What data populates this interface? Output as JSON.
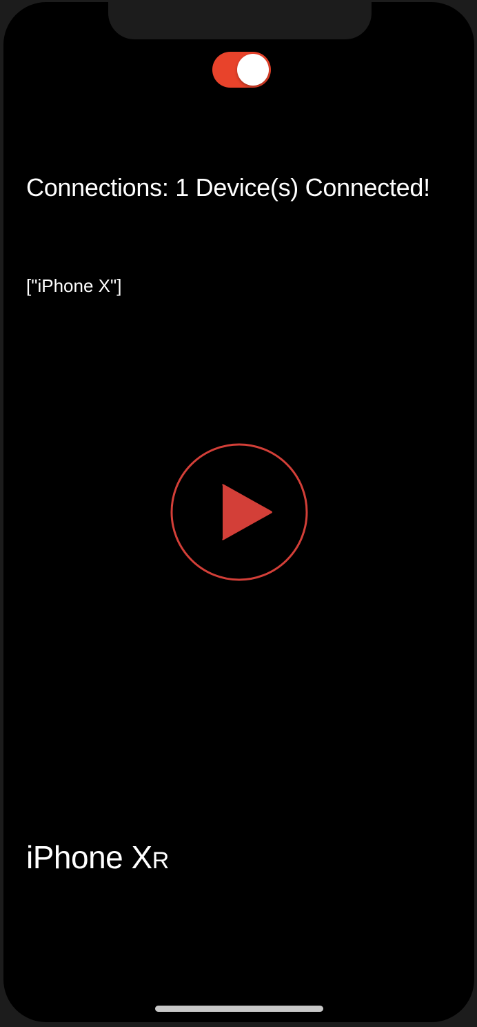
{
  "toggle": {
    "state": "on",
    "on_color": "#e8432b"
  },
  "connections": {
    "text": "Connections: 1 Device(s) Connected!"
  },
  "peers": {
    "text": "[\"iPhone X\"]"
  },
  "play_button": {
    "icon": "play-icon",
    "color": "#d33f38"
  },
  "device": {
    "name_main": "iPhone X",
    "name_suffix": "R"
  }
}
